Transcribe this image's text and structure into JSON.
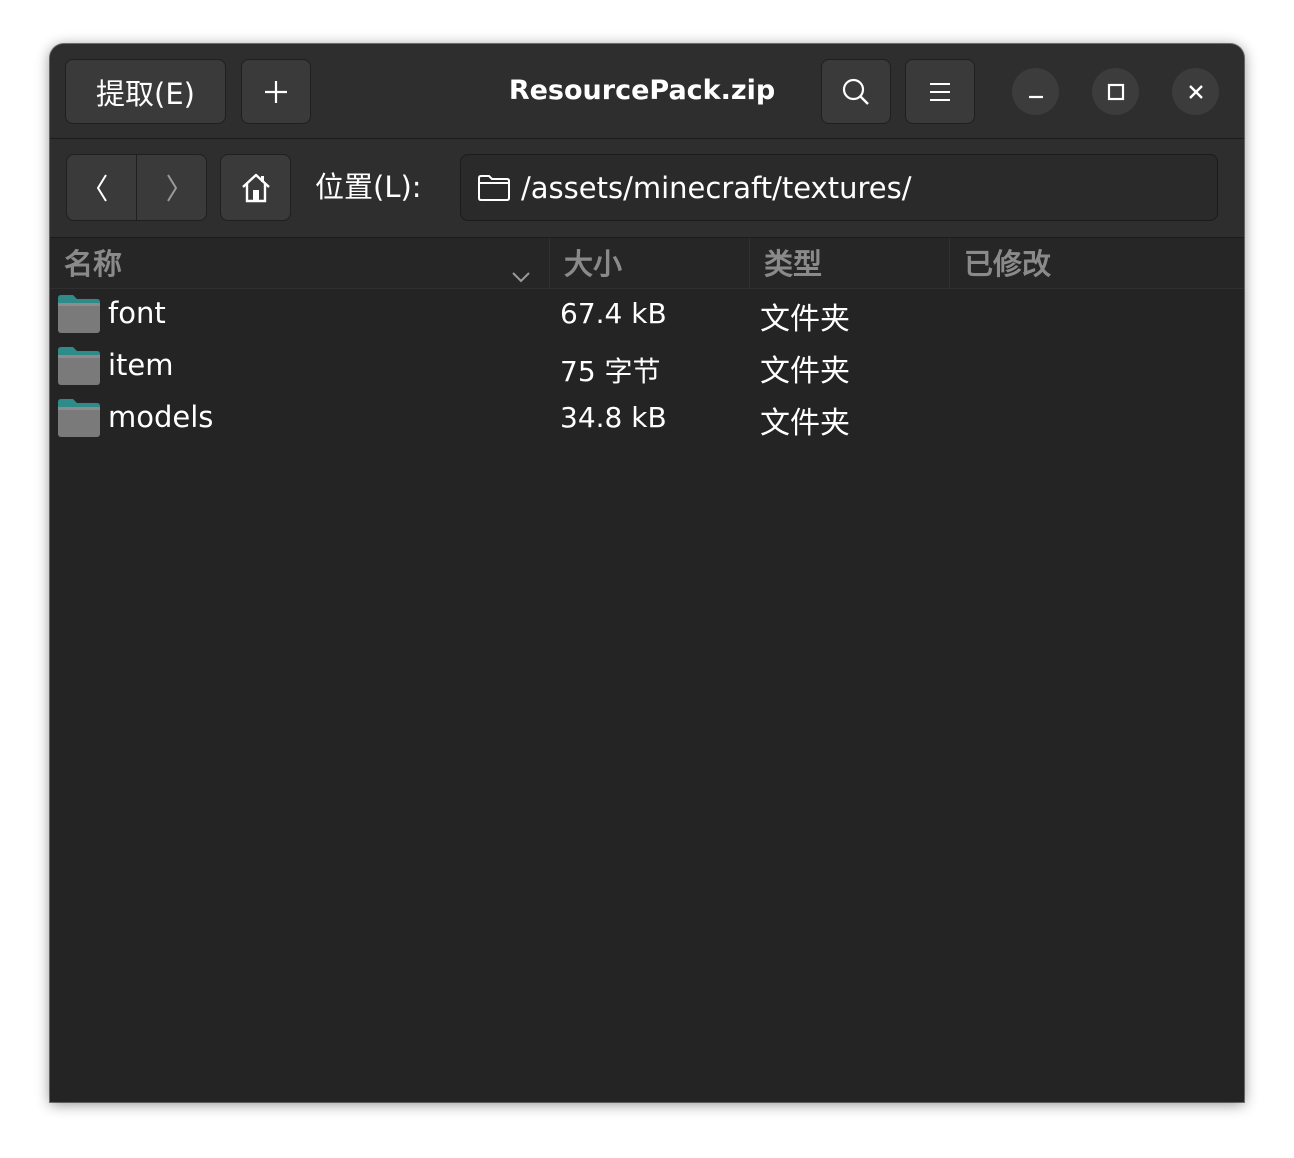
{
  "window": {
    "title": "ResourcePack.zip"
  },
  "headerbar": {
    "extract_label": "提取(E)",
    "new_icon": "plus-icon",
    "search_icon": "search-icon",
    "menu_icon": "hamburger-menu-icon",
    "minimize_icon": "minimize-icon",
    "maximize_icon": "maximize-icon",
    "close_icon": "close-icon"
  },
  "locationbar": {
    "back_icon": "chevron-left-icon",
    "forward_icon": "chevron-right-icon",
    "home_icon": "home-icon",
    "location_label": "位置(L):",
    "path": "/assets/minecraft/textures/",
    "path_icon": "folder-outline-icon"
  },
  "list": {
    "columns": [
      {
        "label": "名称"
      },
      {
        "label": "大小"
      },
      {
        "label": "类型"
      },
      {
        "label": "已修改"
      }
    ],
    "sort_icon": "chevron-down-icon",
    "rows": [
      {
        "name": "font",
        "size": "67.4 kB",
        "type": "文件夹",
        "modified": ""
      },
      {
        "name": "item",
        "size": "75 字节",
        "type": "文件夹",
        "modified": ""
      },
      {
        "name": "models",
        "size": "34.8 kB",
        "type": "文件夹",
        "modified": ""
      }
    ]
  },
  "colors": {
    "window_bg": "#242424",
    "headerbar_bg": "#2e2e2e",
    "button_bg": "#3a3a3a",
    "folder_teal": "#2f8a8a",
    "folder_gray": "#7a7a7a",
    "header_text": "#8a8a8a",
    "text": "#ffffff"
  }
}
